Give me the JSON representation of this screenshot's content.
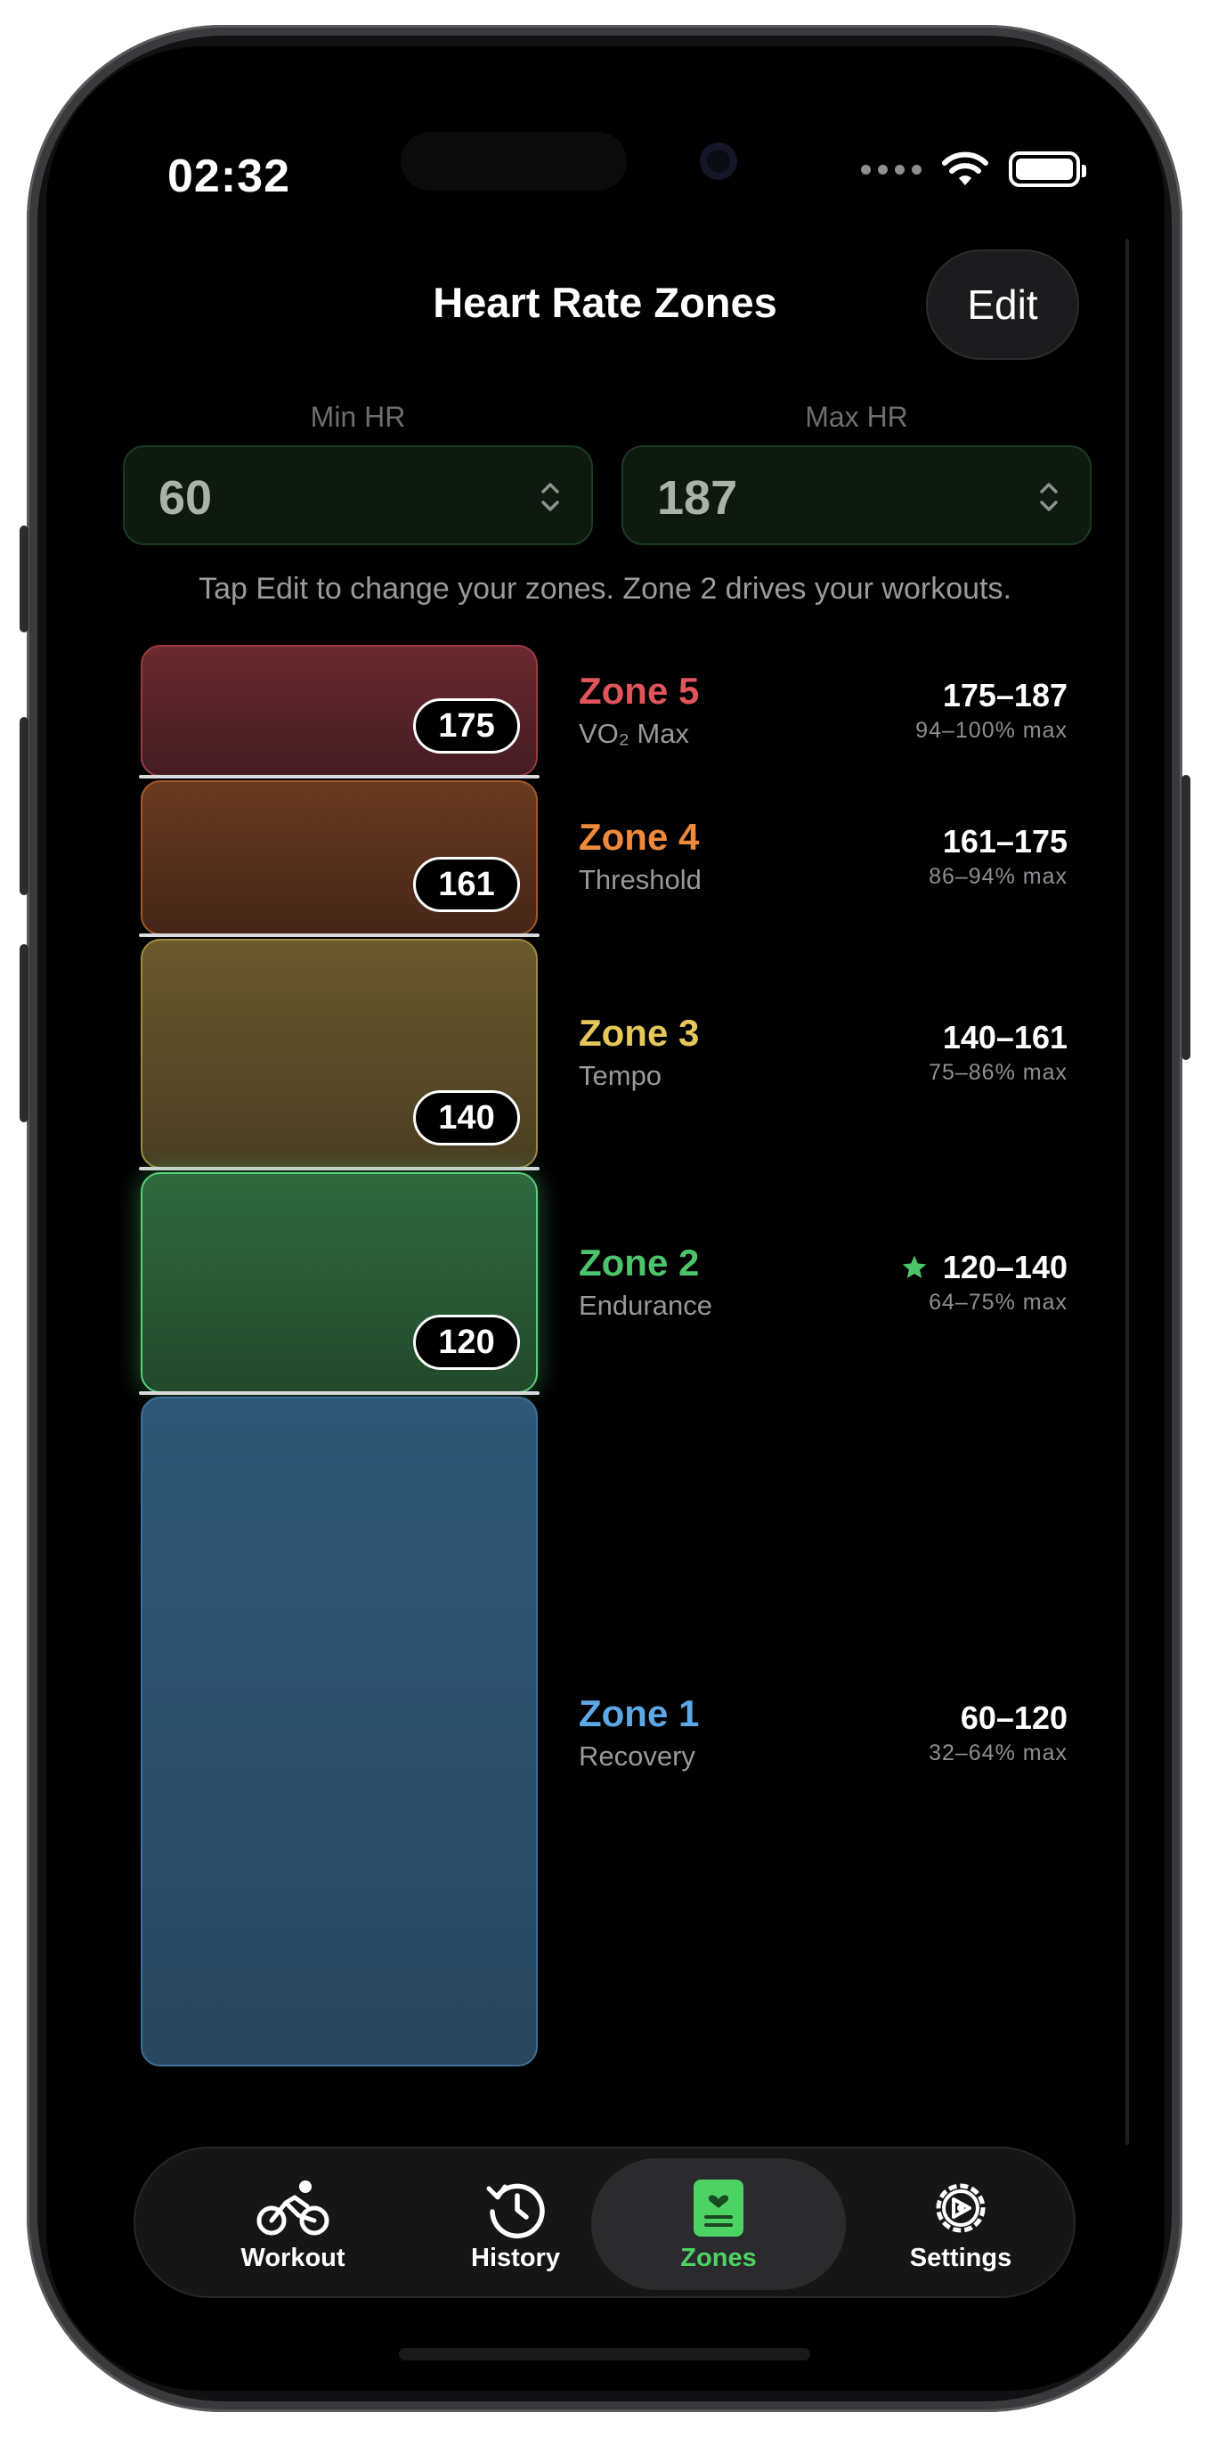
{
  "status": {
    "time": "02:32"
  },
  "header": {
    "title": "Heart Rate Zones",
    "edit_label": "Edit"
  },
  "hr": {
    "min_label": "Min HR",
    "min_value": "60",
    "max_label": "Max HR",
    "max_value": "187"
  },
  "hint": "Tap Edit to change your zones. Zone 2 drives your workouts.",
  "zones": [
    {
      "name": "Zone 5",
      "subtitle": "VO₂ Max",
      "range": "175–187",
      "pct": "94–100% max",
      "boundary": "175",
      "color": "#e0555b"
    },
    {
      "name": "Zone 4",
      "subtitle": "Threshold",
      "range": "161–175",
      "pct": "86–94% max",
      "boundary": "161",
      "color": "#ef8a3c"
    },
    {
      "name": "Zone 3",
      "subtitle": "Tempo",
      "range": "140–161",
      "pct": "75–86% max",
      "boundary": "140",
      "color": "#e6c75a"
    },
    {
      "name": "Zone 2",
      "subtitle": "Endurance",
      "range": "120–140",
      "pct": "64–75% max",
      "boundary": "120",
      "color": "#4cc46a",
      "starred": true
    },
    {
      "name": "Zone 1",
      "subtitle": "Recovery",
      "range": "60–120",
      "pct": "32–64% max",
      "color": "#5ea8e6"
    }
  ],
  "tabs": [
    {
      "label": "Workout",
      "icon": "bicycle-icon"
    },
    {
      "label": "History",
      "icon": "history-clock-icon"
    },
    {
      "label": "Zones",
      "icon": "zones-card-icon",
      "active": true
    },
    {
      "label": "Settings",
      "icon": "gear-icon"
    }
  ],
  "colors": {
    "accent": "#4cd364",
    "background": "#000000"
  }
}
